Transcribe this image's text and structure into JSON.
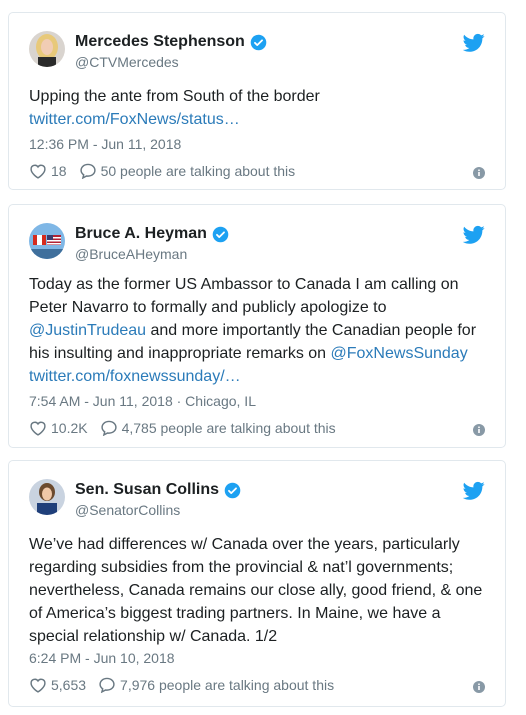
{
  "tweets": [
    {
      "name": "Mercedes Stephenson",
      "handle": "@CTVMercedes",
      "text": "Upping the ante from South of the border",
      "link": "twitter.com/FoxNews/status…",
      "time": "12:36 PM - Jun 11, 2018",
      "likes": "18",
      "talking": "50 people are talking about this"
    },
    {
      "name": "Bruce A. Heyman",
      "handle": "@BruceAHeyman",
      "text_lines": [
        "Today as the former US Ambassor to Canada I am calling on",
        "Peter Navarro to formally and publicly apologize to",
        "and more importantly the Canadian people for",
        "his insulting and inappropriate remarks on"
      ],
      "mention1": "@JustinTrudeau",
      "mention2": "@FoxNewsSunday",
      "link": "twitter.com/foxnewssunday/…",
      "time": "7:54 AM - Jun 11, 2018 · Chicago, IL",
      "likes": "10.2K",
      "talking": "4,785 people are talking about this"
    },
    {
      "name": "Sen. Susan Collins",
      "handle": "@SenatorCollins",
      "text_lines": [
        "We’ve had differences w/ Canada over the years, particularly",
        "regarding subsidies from the provincial & nat’l governments;",
        "nevertheless, Canada remains our close ally, good friend, & one",
        "of America’s biggest trading partners. In Maine, we have a",
        "special relationship w/ Canada. 1/2"
      ],
      "time": "6:24 PM - Jun 10, 2018",
      "likes": "5,653",
      "talking": "7,976 people are talking about this"
    }
  ],
  "colors": {
    "link": "#2b7bb9",
    "meta": "#697882",
    "verified": "#1da1f2",
    "bird": "#1da1f2"
  },
  "icons": [
    "verified-badge-icon",
    "twitter-bird-icon",
    "heart-icon",
    "reply-bubble-icon",
    "info-icon"
  ]
}
